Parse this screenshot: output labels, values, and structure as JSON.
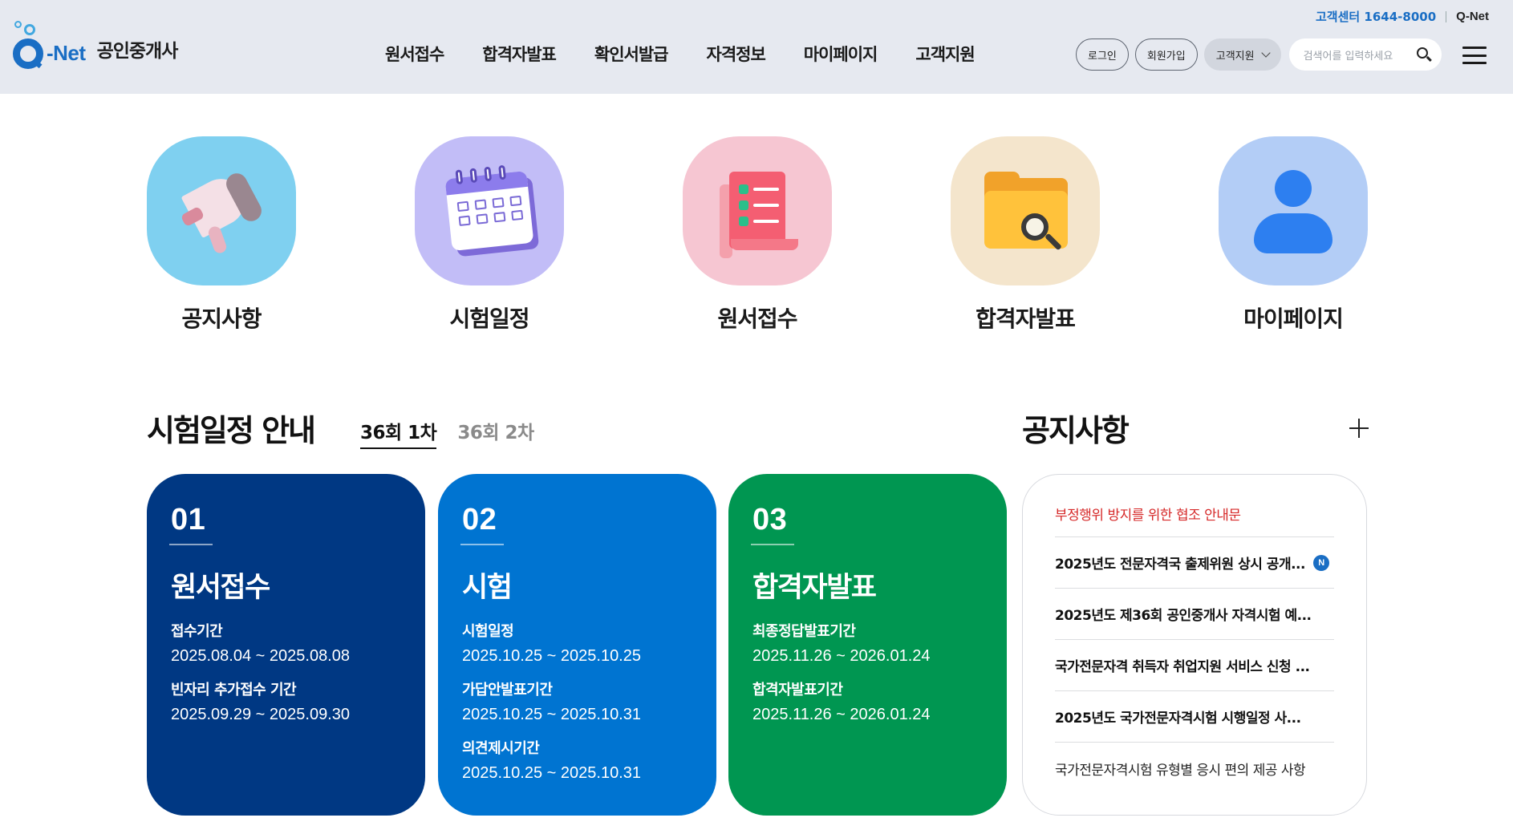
{
  "header": {
    "logo_text": "-Net",
    "site_title": "공인중개사",
    "nav": [
      "원서접수",
      "합격자발표",
      "확인서발급",
      "자격정보",
      "마이페이지",
      "고객지원"
    ],
    "customer_center": "고객센터 1644-8000",
    "qnet_link": "Q-Net",
    "login": "로그인",
    "signup": "회원가입",
    "support_select": "고객지원",
    "search_placeholder": "검색어를 입력하세요"
  },
  "quick_menu": [
    {
      "label": "공지사항",
      "icon": "megaphone-icon",
      "bg": "#7fd0f0"
    },
    {
      "label": "시험일정",
      "icon": "calendar-icon",
      "bg": "#c2bdf7"
    },
    {
      "label": "원서접수",
      "icon": "document-icon",
      "bg": "#f6c6d2"
    },
    {
      "label": "합격자발표",
      "icon": "folder-search-icon",
      "bg": "#f4e5cc"
    },
    {
      "label": "마이페이지",
      "icon": "user-icon",
      "bg": "#b3cdf6"
    }
  ],
  "schedule": {
    "title": "시험일정 안내",
    "tabs": [
      "36회 1차",
      "36회 2차"
    ],
    "active_tab": "36회 1차",
    "cards": [
      {
        "num": "01",
        "title": "원서접수",
        "color": "#003883",
        "items": [
          {
            "label": "접수기간",
            "date": "2025.08.04 ~ 2025.08.08"
          },
          {
            "label": "빈자리 추가접수 기간",
            "date": "2025.09.29 ~ 2025.09.30"
          }
        ]
      },
      {
        "num": "02",
        "title": "시험",
        "color": "#0074d1",
        "items": [
          {
            "label": "시험일정",
            "date": "2025.10.25 ~ 2025.10.25"
          },
          {
            "label": "가답안발표기간",
            "date": "2025.10.25 ~ 2025.10.31"
          },
          {
            "label": "의견제시기간",
            "date": "2025.10.25 ~ 2025.10.31"
          }
        ]
      },
      {
        "num": "03",
        "title": "합격자발표",
        "color": "#009651",
        "items": [
          {
            "label": "최종정답발표기간",
            "date": "2025.11.26 ~ 2026.01.24"
          },
          {
            "label": "합격자발표기간",
            "date": "2025.11.26 ~ 2026.01.24"
          }
        ]
      }
    ]
  },
  "notice": {
    "title": "공지사항",
    "items": [
      {
        "text": "부정행위 방지를 위한 협조 안내문",
        "style": "alert"
      },
      {
        "text": "2025년도 전문자격국 출제위원 상시 공개...",
        "style": "bold",
        "badge": "N"
      },
      {
        "text": "2025년도 제36회 공인중개사 자격시험 예...",
        "style": "bold"
      },
      {
        "text": "국가전문자격 취득자 취업지원 서비스 신청 ...",
        "style": "bold"
      },
      {
        "text": "2025년도 국가전문자격시험 시행일정 사...",
        "style": "bold"
      },
      {
        "text": "국가전문자격시험 유형별 응시 편의 제공 사항",
        "style": "normal"
      }
    ]
  }
}
